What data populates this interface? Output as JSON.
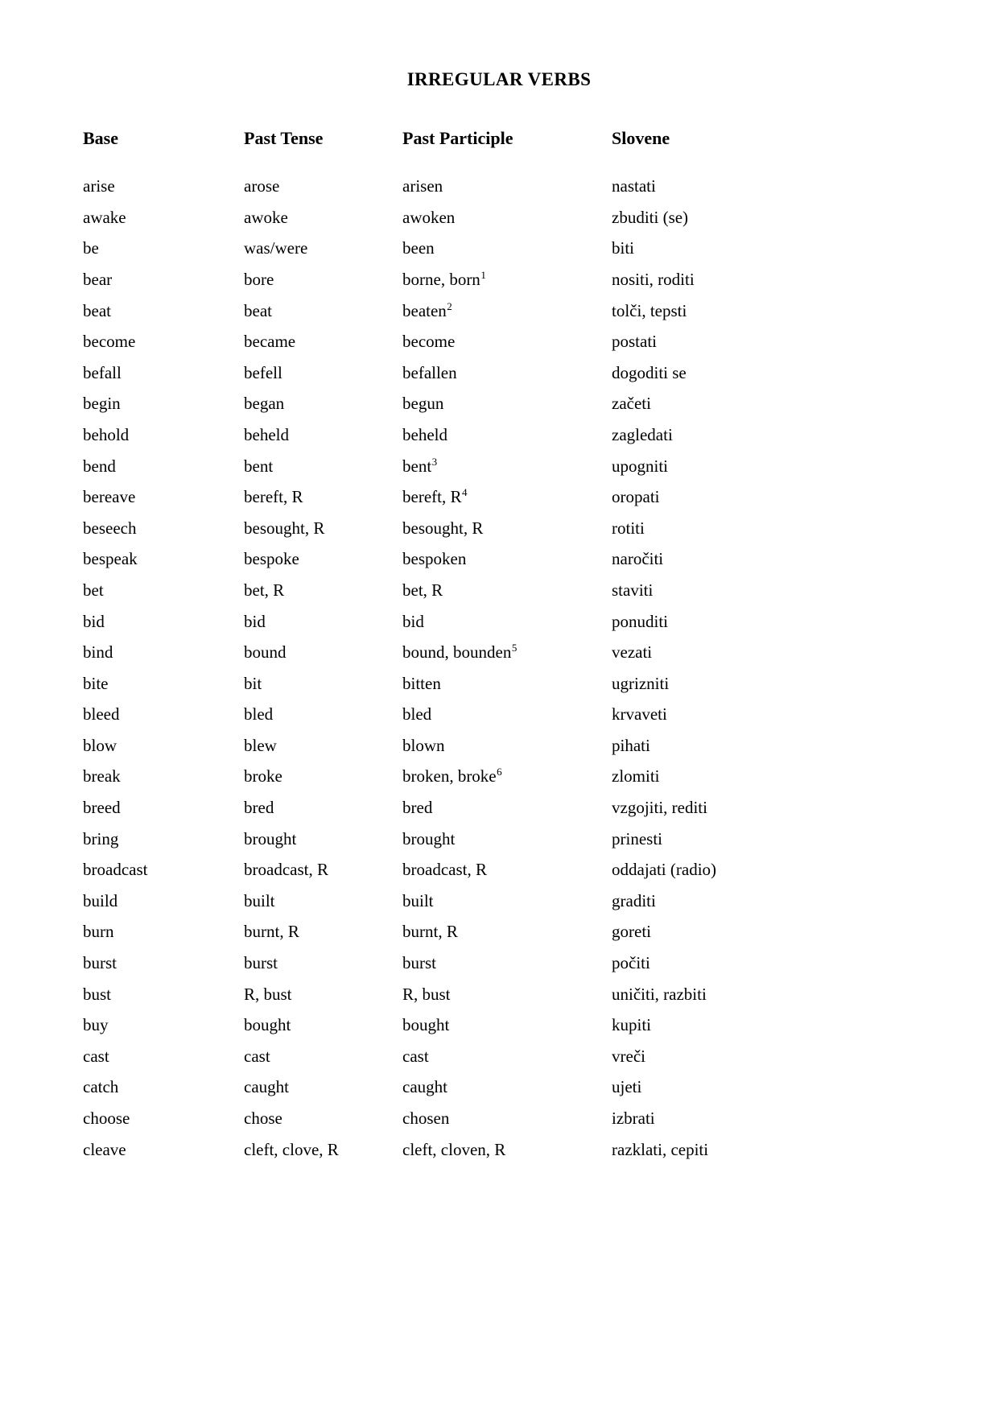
{
  "document": {
    "title": "IRREGULAR VERBS"
  },
  "table": {
    "headers": [
      "Base",
      "Past Tense",
      "Past Participle",
      "Slovene"
    ],
    "rows": [
      {
        "base": "arise",
        "past": "arose",
        "participle": "arisen",
        "participle_footnote": "",
        "slovene": "nastati"
      },
      {
        "base": "awake",
        "past": "awoke",
        "participle": "awoken",
        "participle_footnote": "",
        "slovene": "zbuditi (se)"
      },
      {
        "base": "be",
        "past": "was/were",
        "participle": "been",
        "participle_footnote": "",
        "slovene": "biti"
      },
      {
        "base": "bear",
        "past": "bore",
        "participle": "borne, born",
        "participle_footnote": "1",
        "slovene": "nositi, roditi"
      },
      {
        "base": "beat",
        "past": "beat",
        "participle": "beaten",
        "participle_footnote": "2",
        "slovene": "tolči, tepsti"
      },
      {
        "base": "become",
        "past": "became",
        "participle": "become",
        "participle_footnote": "",
        "slovene": "postati"
      },
      {
        "base": "befall",
        "past": "befell",
        "participle": "befallen",
        "participle_footnote": "",
        "slovene": "dogoditi se"
      },
      {
        "base": "begin",
        "past": "began",
        "participle": "begun",
        "participle_footnote": "",
        "slovene": "začeti"
      },
      {
        "base": "behold",
        "past": "beheld",
        "participle": "beheld",
        "participle_footnote": "",
        "slovene": "zagledati"
      },
      {
        "base": "bend",
        "past": "bent",
        "participle": "bent",
        "participle_footnote": "3",
        "slovene": "upogniti"
      },
      {
        "base": "bereave",
        "past": "bereft, R",
        "participle": "bereft, R",
        "participle_footnote": "4",
        "slovene": "oropati"
      },
      {
        "base": "beseech",
        "past": "besought, R",
        "participle": "besought, R",
        "participle_footnote": "",
        "slovene": "rotiti"
      },
      {
        "base": "bespeak",
        "past": "bespoke",
        "participle": "bespoken",
        "participle_footnote": "",
        "slovene": "naročiti"
      },
      {
        "base": "bet",
        "past": "bet, R",
        "participle": "bet, R",
        "participle_footnote": "",
        "slovene": "staviti"
      },
      {
        "base": "bid",
        "past": "bid",
        "participle": "bid",
        "participle_footnote": "",
        "slovene": "ponuditi"
      },
      {
        "base": "bind",
        "past": "bound",
        "participle": "bound, bounden",
        "participle_footnote": "5",
        "slovene": "vezati"
      },
      {
        "base": "bite",
        "past": "bit",
        "participle": "bitten",
        "participle_footnote": "",
        "slovene": "ugrizniti"
      },
      {
        "base": "bleed",
        "past": "bled",
        "participle": "bled",
        "participle_footnote": "",
        "slovene": "krvaveti"
      },
      {
        "base": "blow",
        "past": "blew",
        "participle": "blown",
        "participle_footnote": "",
        "slovene": "pihati"
      },
      {
        "base": "break",
        "past": "broke",
        "participle": "broken, broke",
        "participle_footnote": "6",
        "slovene": "zlomiti"
      },
      {
        "base": "breed",
        "past": "bred",
        "participle": "bred",
        "participle_footnote": "",
        "slovene": "vzgojiti, rediti"
      },
      {
        "base": "bring",
        "past": "brought",
        "participle": "brought",
        "participle_footnote": "",
        "slovene": "prinesti"
      },
      {
        "base": "broadcast",
        "past": "broadcast, R",
        "participle": "broadcast, R",
        "participle_footnote": "",
        "slovene": "oddajati (radio)"
      },
      {
        "base": "build",
        "past": "built",
        "participle": "built",
        "participle_footnote": "",
        "slovene": "graditi"
      },
      {
        "base": "burn",
        "past": "burnt, R",
        "participle": "burnt, R",
        "participle_footnote": "",
        "slovene": "goreti"
      },
      {
        "base": "burst",
        "past": "burst",
        "participle": "burst",
        "participle_footnote": "",
        "slovene": "počiti"
      },
      {
        "base": "bust",
        "past": "R, bust",
        "participle": "R, bust",
        "participle_footnote": "",
        "slovene": "uničiti, razbiti"
      },
      {
        "base": "buy",
        "past": "bought",
        "participle": "bought",
        "participle_footnote": "",
        "slovene": "kupiti"
      },
      {
        "base": "cast",
        "past": "cast",
        "participle": "cast",
        "participle_footnote": "",
        "slovene": "vreči"
      },
      {
        "base": "catch",
        "past": "caught",
        "participle": "caught",
        "participle_footnote": "",
        "slovene": "ujeti"
      },
      {
        "base": "choose",
        "past": "chose",
        "participle": "chosen",
        "participle_footnote": "",
        "slovene": "izbrati"
      },
      {
        "base": "cleave",
        "past": "cleft, clove, R",
        "participle": "cleft, cloven, R",
        "participle_footnote": "",
        "slovene": "razklati, cepiti"
      }
    ]
  }
}
